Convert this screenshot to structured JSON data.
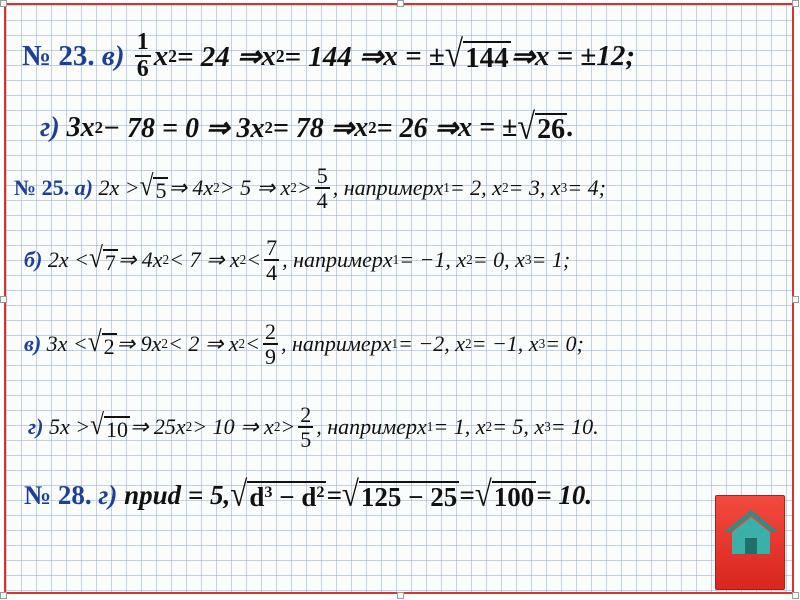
{
  "rows": [
    {
      "num": "№ 23.",
      "label": "в)",
      "f1n": "1",
      "f1d": "6",
      "t1": "x",
      "p1": "2",
      "t2": "= 24 ⇒ ",
      "t3": "x",
      "p3": "2",
      "t4": " = 144 ⇒ ",
      "t5": "x = ±",
      "r1": "144",
      "t6": " ⇒ ",
      "t7": "x = ±12;"
    },
    {
      "label": "г)",
      "t1": "3x",
      "p1": "2",
      "t2": " − 78 = 0 ⇒ 3x",
      "p2": "2",
      "t3": " = 78 ⇒ ",
      "t4": "x",
      "p4": "2",
      "t5": " = 26 ⇒ ",
      "t6": "x = ±",
      "r1": "26",
      "t7": "."
    },
    {
      "num": "№ 25.",
      "label": "а)",
      "t1": "2x > ",
      "r1": "5",
      "t2": " ⇒ 4x",
      "p2": "2",
      "t3": " > 5 ⇒ x",
      "p3": "2",
      "t4": " > ",
      "fn": "5",
      "fd": "4",
      "t5": ", например ",
      "t6": "x",
      "s6": "1",
      "t7": " = 2, x",
      "s7": "2",
      "t8": " = 3, x",
      "s8": "3",
      "t9": " = 4;"
    },
    {
      "label": "б)",
      "t1": "2x < ",
      "r1": "7",
      "t2": " ⇒ 4x",
      "p2": "2",
      "t3": " < 7 ⇒ x",
      "p3": "2",
      "t4": " < ",
      "fn": "7",
      "fd": "4",
      "t5": ", например ",
      "t6": "x",
      "s6": "1",
      "t7": " = −1, x",
      "s7": "2",
      "t8": " = 0, x",
      "s8": "3",
      "t9": " = 1;"
    },
    {
      "label": "в)",
      "t1": "3x < ",
      "r1": "2",
      "t2": " ⇒ 9x",
      "p2": "2",
      "t3": " < 2 ⇒ x",
      "p3": "2",
      "t4": " < ",
      "fn": "2",
      "fd": "9",
      "t5": ", например ",
      "t6": "x",
      "s6": "1",
      "t7": " = −2, x",
      "s7": "2",
      "t8": " = −1, x",
      "s8": "3",
      "t9": " = 0;"
    },
    {
      "label": "г)",
      "t1": "5x > ",
      "r1": "10",
      "t2": " ⇒ 25x",
      "p2": "2",
      "t3": " > 10 ⇒ x",
      "p3": "2",
      "t4": " > ",
      "fn": "2",
      "fd": "5",
      "t5": ", например ",
      "t6": "x",
      "s6": "1",
      "t7": " = 1, x",
      "s7": "2",
      "t8": " = 5, x",
      "s8": "3",
      "t9": " = 10."
    },
    {
      "num": "№ 28.",
      "label": "г)",
      "t1": "при ",
      "t2": "d = 5, ",
      "r1a": "d",
      "r1ap": "3",
      "r1b": " − d",
      "r1bp": "2",
      "t3": " = ",
      "r2": "125 − 25",
      "t4": " = ",
      "r3": "100",
      "t5": " = 10."
    }
  ],
  "home_icon": "home-icon",
  "colors": {
    "border": "#d8342d",
    "label": "#1d3f9a",
    "button": "#e23a30",
    "icon": "#2a8f8a"
  }
}
